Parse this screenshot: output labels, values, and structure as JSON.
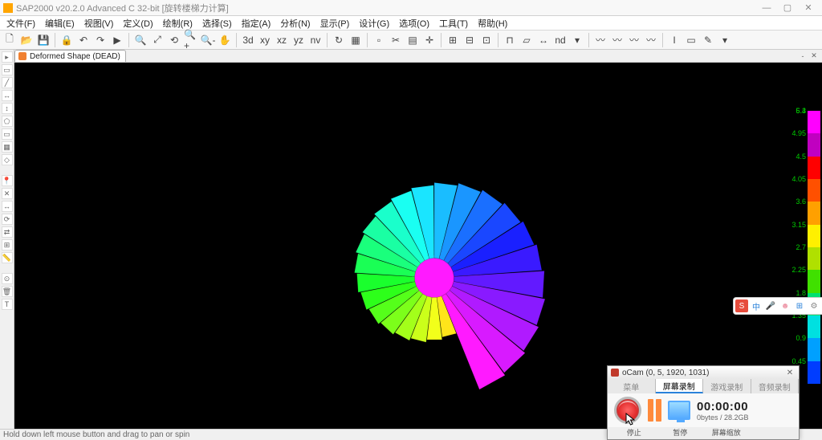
{
  "app": {
    "title": "SAP2000 v20.2.0 Advanced C 32-bit    [旋转楼梯力计算]"
  },
  "window_buttons": {
    "min": "—",
    "max": "▢",
    "close": "✕"
  },
  "menus": [
    "文件(F)",
    "编辑(E)",
    "视图(V)",
    "定义(D)",
    "绘制(R)",
    "选择(S)",
    "指定(A)",
    "分析(N)",
    "显示(P)",
    "设计(G)",
    "选项(O)",
    "工具(T)",
    "帮助(H)"
  ],
  "toolbar_groups": [
    [
      "new-doc",
      "open",
      "save"
    ],
    [
      "lock",
      "undo",
      "redo",
      "run"
    ],
    [
      "zoom-window",
      "zoom-extents",
      "zoom-prev",
      "zoom-in",
      "zoom-out",
      "pan"
    ],
    [
      "3d",
      "xy",
      "xz",
      "yz",
      "nv"
    ],
    [
      "refresh",
      "solid"
    ],
    [
      "object-shrink",
      "section-cut",
      "show-grid",
      "show-axes"
    ],
    [
      "toggle-a",
      "toggle-b",
      "toggle-c"
    ]
  ],
  "toolbar_glyphs": {
    "new-doc": "🗋",
    "open": "📂",
    "save": "💾",
    "lock": "🔒",
    "undo": "↶",
    "redo": "↷",
    "run": "▶",
    "zoom-window": "🔍",
    "zoom-extents": "⤢",
    "zoom-prev": "⟲",
    "zoom-in": "🔍+",
    "zoom-out": "🔍-",
    "pan": "✋",
    "3d": "3d",
    "xy": "xy",
    "xz": "xz",
    "yz": "yz",
    "nv": "nv",
    "refresh": "↻",
    "solid": "▦",
    "object-shrink": "▫",
    "section-cut": "✂",
    "show-grid": "▤",
    "show-axes": "✛",
    "toggle-a": "⊞",
    "toggle-b": "⊟",
    "toggle-c": "⊡"
  },
  "toolbar2": [
    "frame",
    "shell",
    "link",
    "nd",
    "assign-dropdown"
  ],
  "toolbar2_glyphs": {
    "frame": "⊓",
    "shell": "▱",
    "link": "↔",
    "nd": "nd",
    "assign-dropdown": "▾"
  },
  "toolbar3": [
    "I",
    "box",
    "edit",
    "design-dropdown"
  ],
  "toolbar3_glyphs": {
    "I": "I",
    "box": "▭",
    "edit": "✎",
    "design-dropdown": "▾"
  },
  "left_tools": [
    "pointer",
    "marquee",
    "line",
    "dim1",
    "dim2",
    "poly",
    "rect",
    "hatch",
    "quad",
    "",
    "pin",
    "cross",
    "move",
    "rotate",
    "mirror",
    "array",
    "tape",
    "",
    "pin2",
    "del",
    "text"
  ],
  "view_tab": {
    "label": "Deformed Shape (DEAD)"
  },
  "panel_buttons": [
    "-",
    "✕"
  ],
  "legend": {
    "colors": [
      "#003dff",
      "#00a0ff",
      "#00e0e0",
      "#00e070",
      "#40e000",
      "#b0e000",
      "#fff000",
      "#ffa000",
      "#ff5000",
      "#ff0000",
      "#c000c0",
      "#ff00ff"
    ],
    "labels": [
      "0.45",
      "0.9",
      "1.35",
      "1.8",
      "2.25",
      "2.7",
      "3.15",
      "3.6",
      "4.05",
      "4.5",
      "4.95",
      "5.4",
      "5.85",
      "6.3"
    ]
  },
  "right_float": [
    {
      "name": "s-logo",
      "glyph": "S",
      "bg": "#e74c3c",
      "fg": "#fff"
    },
    {
      "name": "china",
      "glyph": "中",
      "bg": "#fff",
      "fg": "#2a82da"
    },
    {
      "name": "mic",
      "glyph": "🎤",
      "bg": "#fff",
      "fg": "#2aa"
    },
    {
      "name": "face",
      "glyph": "☻",
      "bg": "#fff",
      "fg": "#e9a"
    },
    {
      "name": "grid",
      "glyph": "⊞",
      "bg": "#fff",
      "fg": "#2a82da"
    },
    {
      "name": "gear",
      "glyph": "⚙",
      "bg": "#fff",
      "fg": "#888"
    }
  ],
  "status": {
    "hint": "Hold down left mouse button and drag to pan or spin"
  },
  "ocam": {
    "title": "oCam (0, 5, 1920, 1031)",
    "tabs": [
      "菜单",
      "屏幕录制",
      "游戏录制",
      "音频录制"
    ],
    "active_tab": 1,
    "buttons": {
      "rec": "停止",
      "pause": "暂停",
      "resolution": "屏幕缩放"
    },
    "time": "00:00:00",
    "bytes": "0bytes / 28.2GB"
  },
  "spiral": {
    "segments": 36,
    "inner_r": 18,
    "outer_r_start": 40,
    "outer_r_end": 150,
    "start_angle": -90,
    "turns": 1.4
  }
}
